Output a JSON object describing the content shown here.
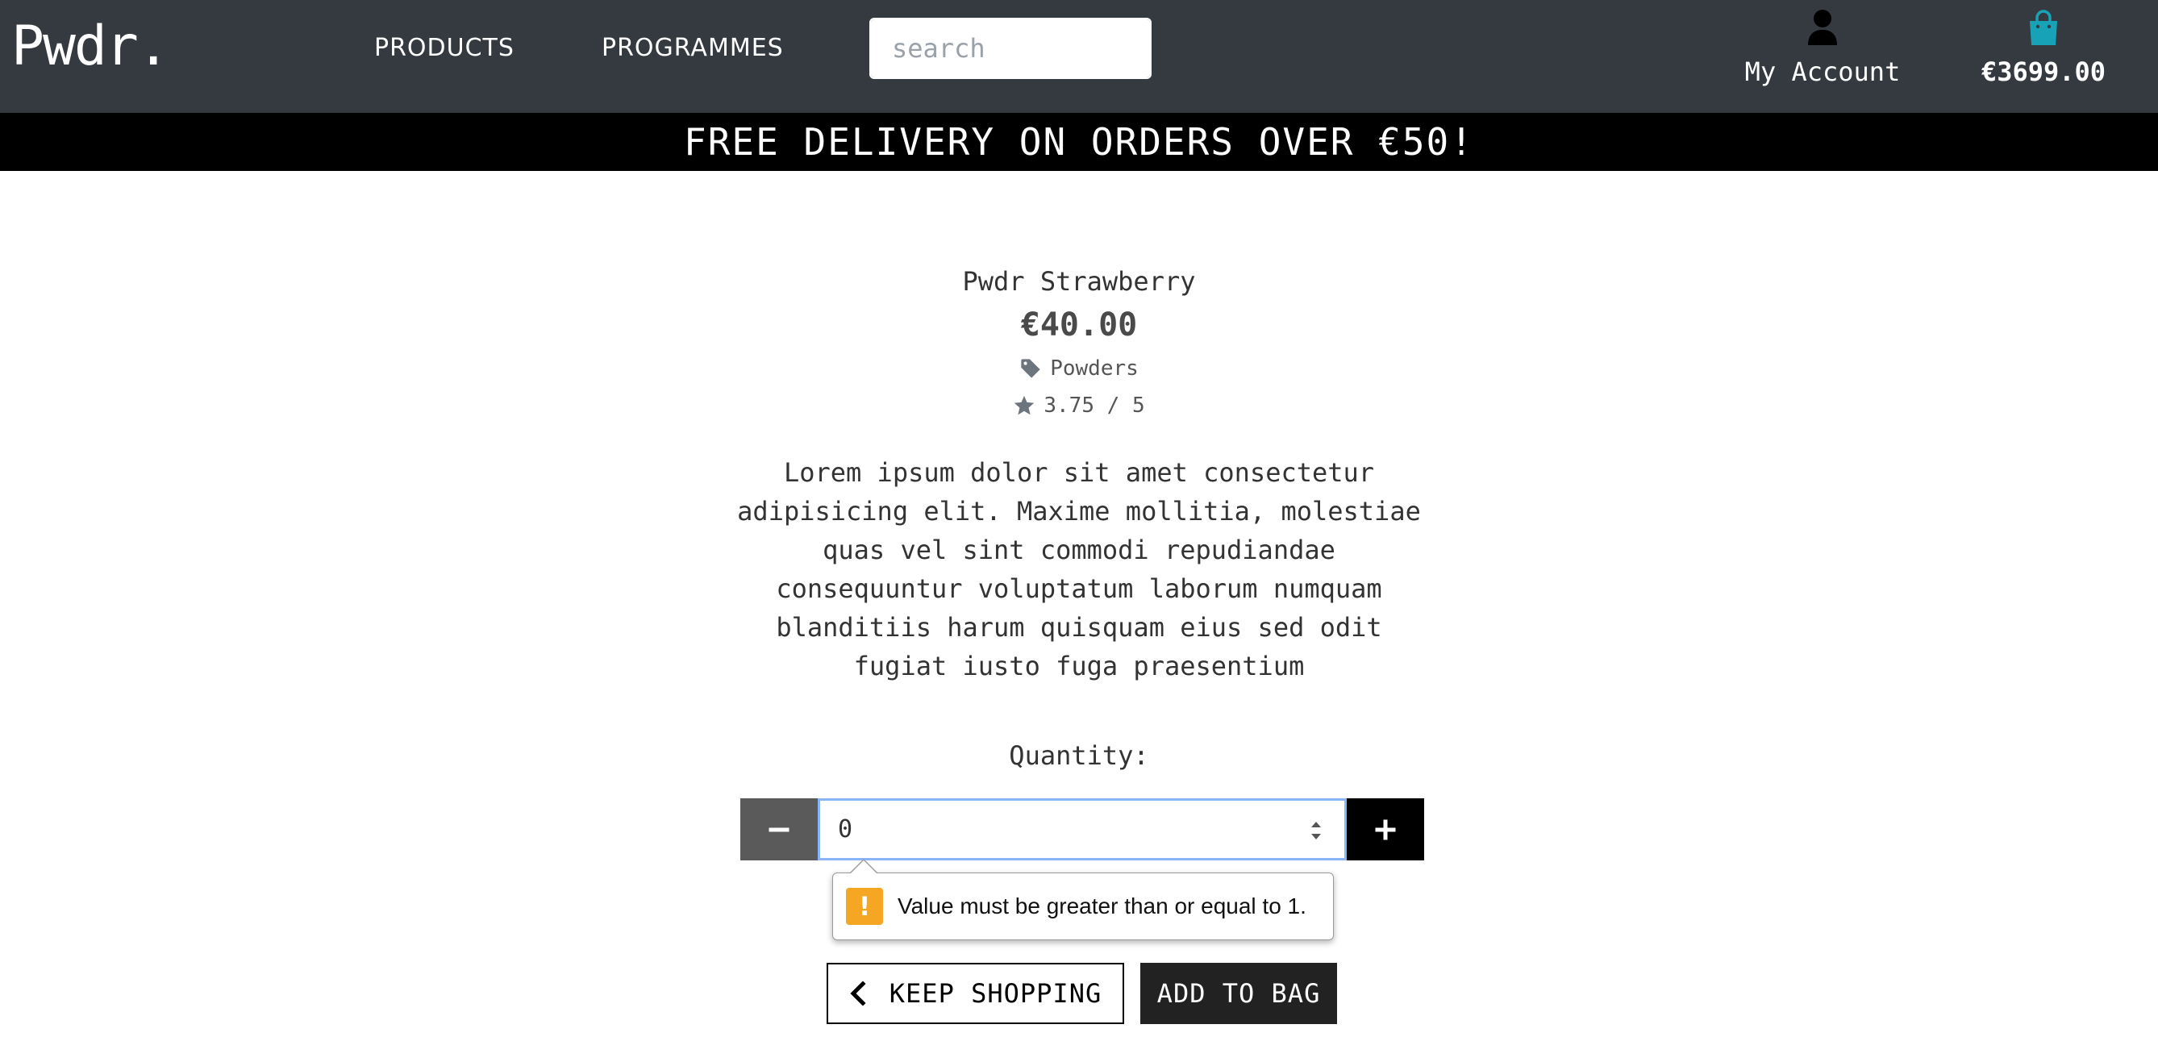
{
  "brand": {
    "logo": "Pwdr."
  },
  "nav": {
    "products": "PRODUCTS",
    "programmes": "PROGRAMMES"
  },
  "search": {
    "placeholder": "search",
    "value": "",
    "icon": "search-icon"
  },
  "account": {
    "label": "My Account",
    "icon": "user-icon"
  },
  "bag": {
    "total": "€3699.00",
    "icon": "shopping-bag-icon",
    "icon_color": "#17a2b8"
  },
  "banner": {
    "text": "FREE DELIVERY ON ORDERS OVER €50!"
  },
  "product": {
    "name": "Pwdr Strawberry",
    "price": "€40.00",
    "category": "Powders",
    "category_icon": "tag-icon",
    "rating": "3.75 / 5",
    "rating_icon": "star-icon",
    "description": "Lorem ipsum dolor sit amet consectetur adipisicing elit. Maxime mollitia, molestiae quas vel sint commodi repudiandae consequuntur voluptatum laborum numquam blanditiis harum quisquam eius sed odit fugiat iusto fuga praesentium"
  },
  "quantity": {
    "label": "Quantity:",
    "value": "0",
    "validation_message": "Value must be greater than or equal to 1.",
    "warning_icon": "!",
    "warning_color": "#f5a623"
  },
  "actions": {
    "keep_shopping": "KEEP SHOPPING",
    "add_to_bag": "ADD TO BAG"
  },
  "colors": {
    "header_bg": "#343a40",
    "banner_bg": "#000000",
    "focus_ring": "#8ab4f8"
  }
}
